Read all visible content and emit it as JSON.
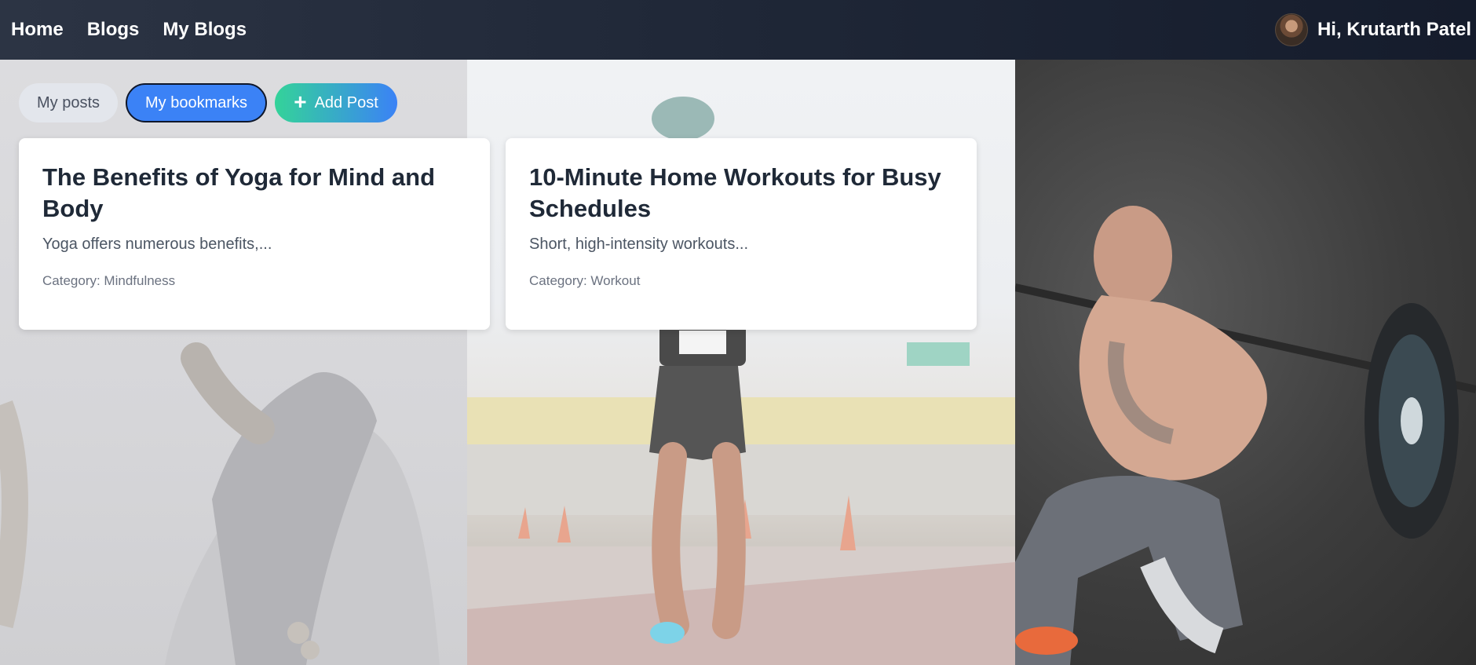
{
  "nav": {
    "links": [
      "Home",
      "Blogs",
      "My Blogs"
    ],
    "greeting": "Hi, Krutarth Patel"
  },
  "controls": {
    "my_posts": "My posts",
    "my_bookmarks": "My bookmarks",
    "add_post": "Add Post",
    "active_tab": "My bookmarks"
  },
  "posts": [
    {
      "title": "The Benefits of Yoga for Mind and Body",
      "excerpt": "Yoga offers numerous benefits,...",
      "category": "Category: Mindfulness"
    },
    {
      "title": "10-Minute Home Workouts for Busy Schedules",
      "excerpt": "Short, high-intensity workouts...",
      "category": "Category: Workout"
    }
  ],
  "colors": {
    "nav_bg": "#1f2737",
    "active_pill": "#3b82f6",
    "add_gradient_start": "#34d399",
    "add_gradient_end": "#3b82f6"
  },
  "icons": {
    "add": "plus-icon",
    "avatar": "user-avatar"
  }
}
